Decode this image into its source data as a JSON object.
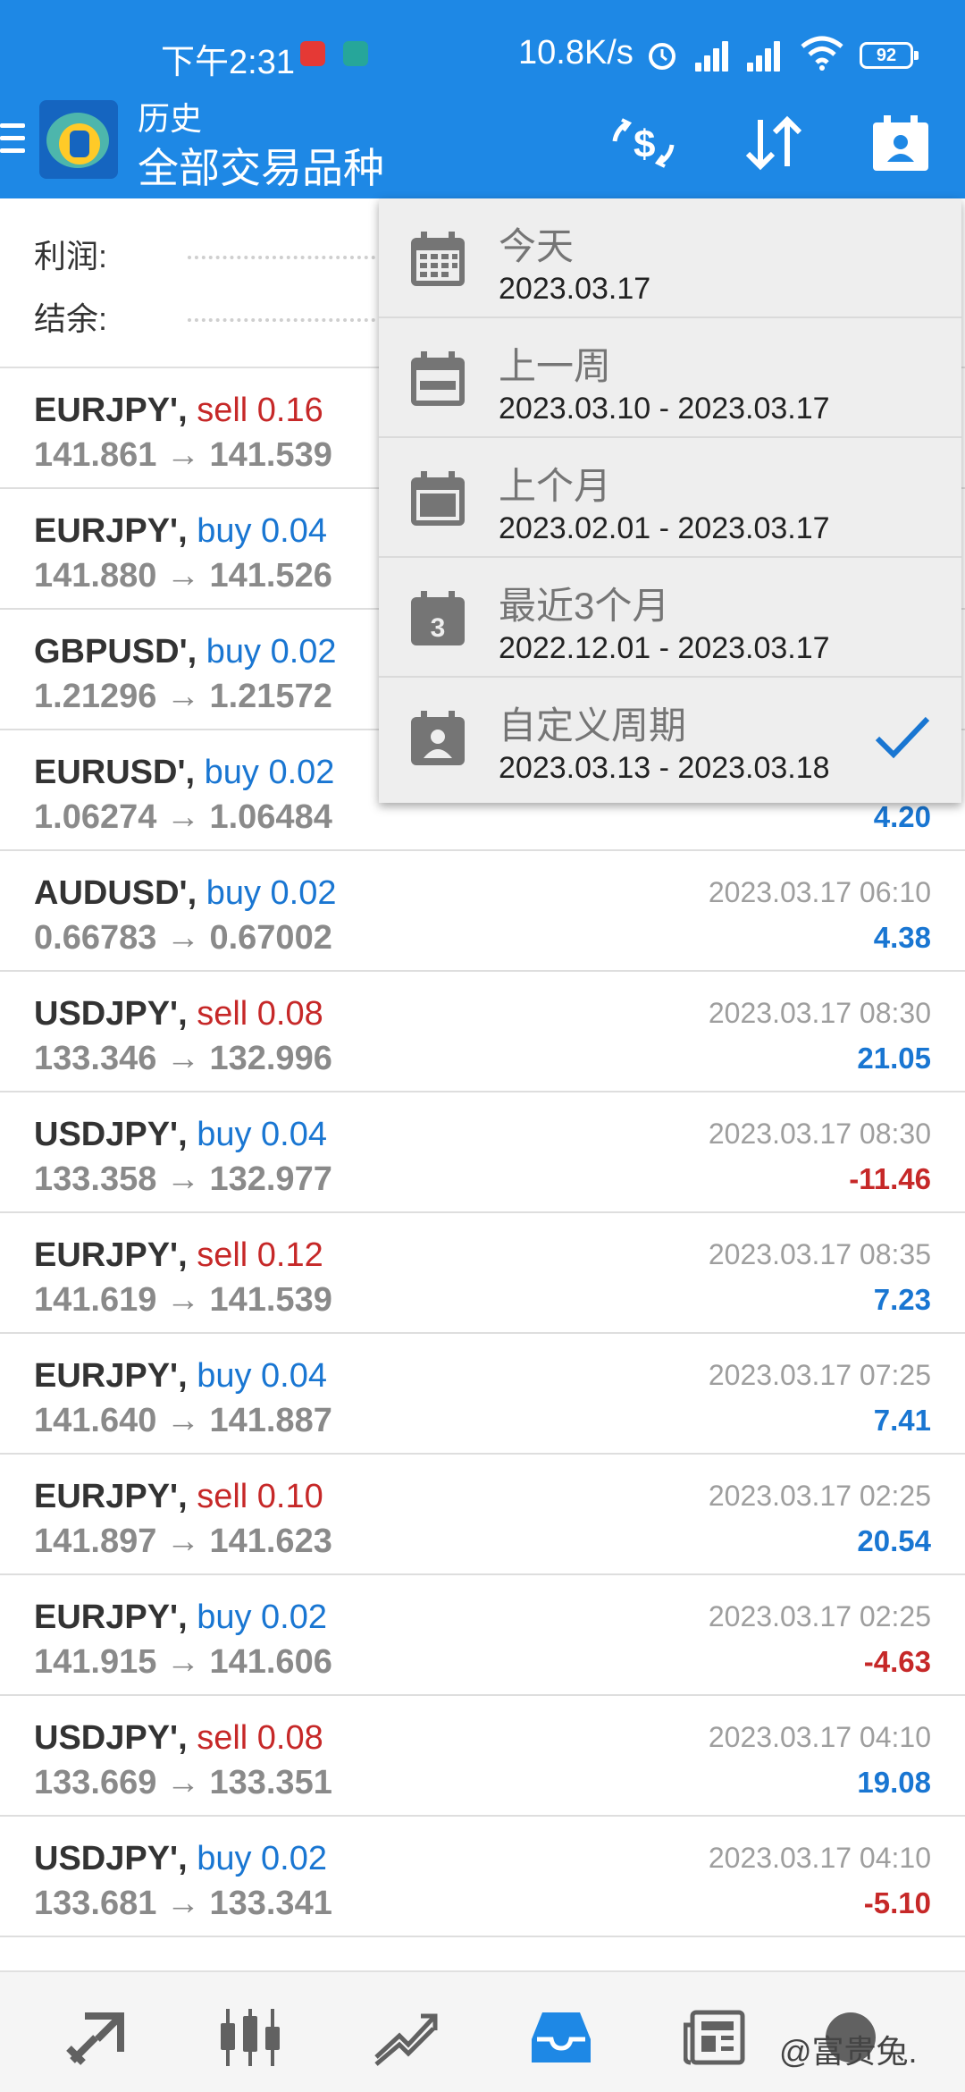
{
  "status_bar": {
    "time": "下午2:31",
    "net_speed": "10.8K/s",
    "battery": "92"
  },
  "header": {
    "subtitle": "历史",
    "title": "全部交易品种",
    "accent_color": "#1e88e5"
  },
  "summary": {
    "profit_label": "利润:",
    "balance_label": "结余:"
  },
  "period_menu": {
    "items": [
      {
        "label": "今天",
        "range": "2023.03.17",
        "icon": "calendar-grid-icon"
      },
      {
        "label": "上一周",
        "range": "2023.03.10 - 2023.03.17",
        "icon": "calendar-week-icon"
      },
      {
        "label": "上个月",
        "range": "2023.02.01 - 2023.03.17",
        "icon": "calendar-month-icon"
      },
      {
        "label": "最近3个月",
        "range": "2022.12.01 - 2023.03.17",
        "icon": "calendar-3-icon",
        "badge": "3"
      },
      {
        "label": "自定义周期",
        "range": "2023.03.13 - 2023.03.18",
        "icon": "calendar-custom-icon",
        "selected": true
      }
    ]
  },
  "deals": [
    {
      "symbol": "EURJPY'",
      "side": "sell 0.16",
      "type": "sell",
      "prices": "141.861 → 141.539",
      "time": "",
      "profit": "",
      "sign": "pos"
    },
    {
      "symbol": "EURJPY'",
      "side": "buy 0.04",
      "type": "buy",
      "prices": "141.880 → 141.526",
      "time": "",
      "profit": "",
      "sign": "pos"
    },
    {
      "symbol": "GBPUSD'",
      "side": "buy 0.02",
      "type": "buy",
      "prices": "1.21296 → 1.21572",
      "time": "",
      "profit": "",
      "sign": "pos"
    },
    {
      "symbol": "EURUSD'",
      "side": "buy 0.02",
      "type": "buy",
      "prices": "1.06274 → 1.06484",
      "time": "",
      "profit": "4.20",
      "sign": "pos"
    },
    {
      "symbol": "AUDUSD'",
      "side": "buy 0.02",
      "type": "buy",
      "prices": "0.66783 → 0.67002",
      "time": "2023.03.17 06:10",
      "profit": "4.38",
      "sign": "pos"
    },
    {
      "symbol": "USDJPY'",
      "side": "sell 0.08",
      "type": "sell",
      "prices": "133.346 → 132.996",
      "time": "2023.03.17 08:30",
      "profit": "21.05",
      "sign": "pos"
    },
    {
      "symbol": "USDJPY'",
      "side": "buy 0.04",
      "type": "buy",
      "prices": "133.358 → 132.977",
      "time": "2023.03.17 08:30",
      "profit": "-11.46",
      "sign": "neg"
    },
    {
      "symbol": "EURJPY'",
      "side": "sell 0.12",
      "type": "sell",
      "prices": "141.619 → 141.539",
      "time": "2023.03.17 08:35",
      "profit": "7.23",
      "sign": "pos"
    },
    {
      "symbol": "EURJPY'",
      "side": "buy 0.04",
      "type": "buy",
      "prices": "141.640 → 141.887",
      "time": "2023.03.17 07:25",
      "profit": "7.41",
      "sign": "pos"
    },
    {
      "symbol": "EURJPY'",
      "side": "sell 0.10",
      "type": "sell",
      "prices": "141.897 → 141.623",
      "time": "2023.03.17 02:25",
      "profit": "20.54",
      "sign": "pos"
    },
    {
      "symbol": "EURJPY'",
      "side": "buy 0.02",
      "type": "buy",
      "prices": "141.915 → 141.606",
      "time": "2023.03.17 02:25",
      "profit": "-4.63",
      "sign": "neg"
    },
    {
      "symbol": "USDJPY'",
      "side": "sell 0.08",
      "type": "sell",
      "prices": "133.669 → 133.351",
      "time": "2023.03.17 04:10",
      "profit": "19.08",
      "sign": "pos"
    },
    {
      "symbol": "USDJPY'",
      "side": "buy 0.02",
      "type": "buy",
      "prices": "133.681 → 133.341",
      "time": "2023.03.17 04:10",
      "profit": "-5.10",
      "sign": "neg"
    }
  ],
  "bottom_nav": {
    "items": [
      "quotes-icon",
      "chart-icon",
      "trade-icon",
      "history-icon",
      "news-icon",
      "chat-icon"
    ],
    "active": "history-icon",
    "watermark": "@富贵兔."
  }
}
